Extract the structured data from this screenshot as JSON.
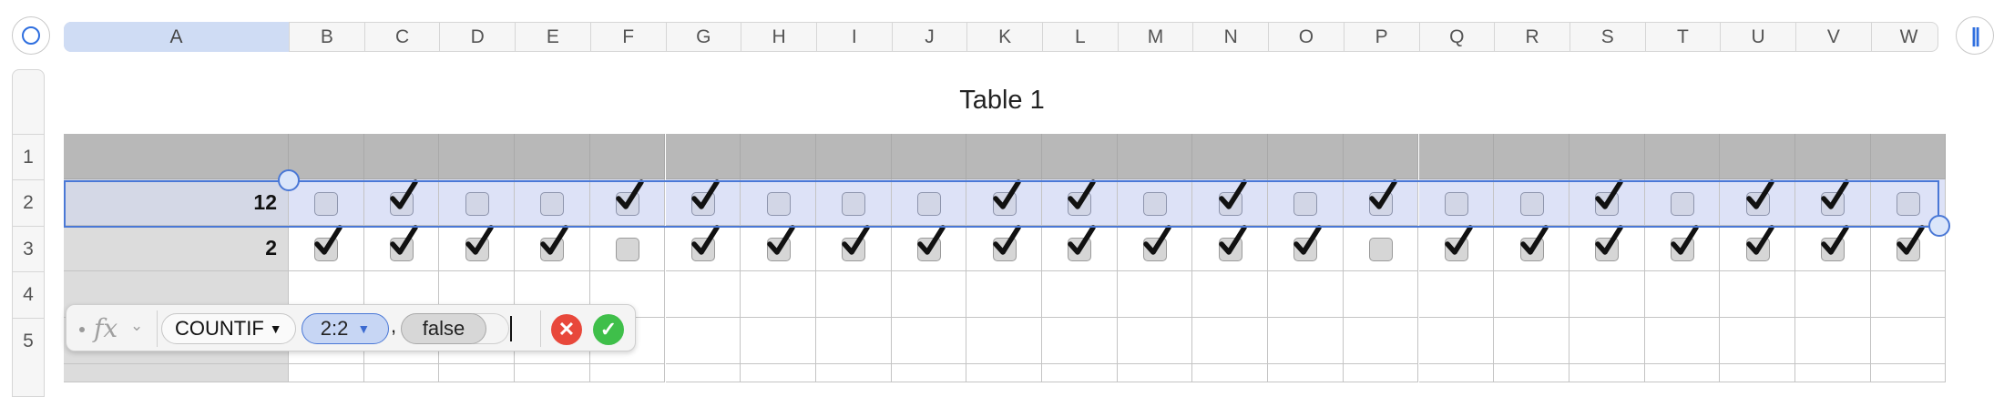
{
  "toolbar": {
    "left_icon": "circle-select-icon",
    "right_icon": "pause-bars-icon",
    "right_label": "||"
  },
  "columns": [
    "A",
    "B",
    "C",
    "D",
    "E",
    "F",
    "G",
    "H",
    "I",
    "J",
    "K",
    "L",
    "M",
    "N",
    "O",
    "P",
    "Q",
    "R",
    "S",
    "T",
    "U",
    "V",
    "W"
  ],
  "selected_column": "A",
  "rows": [
    "1",
    "2",
    "3",
    "4",
    "5"
  ],
  "table": {
    "title": "Table 1",
    "row2_value": "12",
    "row3_value": "2",
    "row2_checks": [
      false,
      true,
      false,
      false,
      true,
      true,
      false,
      false,
      false,
      true,
      true,
      false,
      true,
      false,
      true,
      false,
      false,
      true,
      false,
      true,
      true,
      false
    ],
    "row3_checks": [
      true,
      true,
      true,
      true,
      false,
      true,
      true,
      true,
      true,
      true,
      true,
      true,
      true,
      true,
      false,
      true,
      true,
      true,
      true,
      true,
      true,
      true
    ]
  },
  "formula": {
    "fx_label": "fx",
    "chevron": "⌄",
    "function_name": "COUNTIF",
    "function_caret": "▼",
    "range_ref": "2:2",
    "range_caret": "▼",
    "separator": ",",
    "criterion": "false",
    "cancel_symbol": "✕",
    "accept_symbol": "✓"
  },
  "colors": {
    "accent": "#4a78d6",
    "selection_fill": "#dde2f7",
    "cancel": "#e8483b",
    "accept": "#3fbf4a"
  }
}
